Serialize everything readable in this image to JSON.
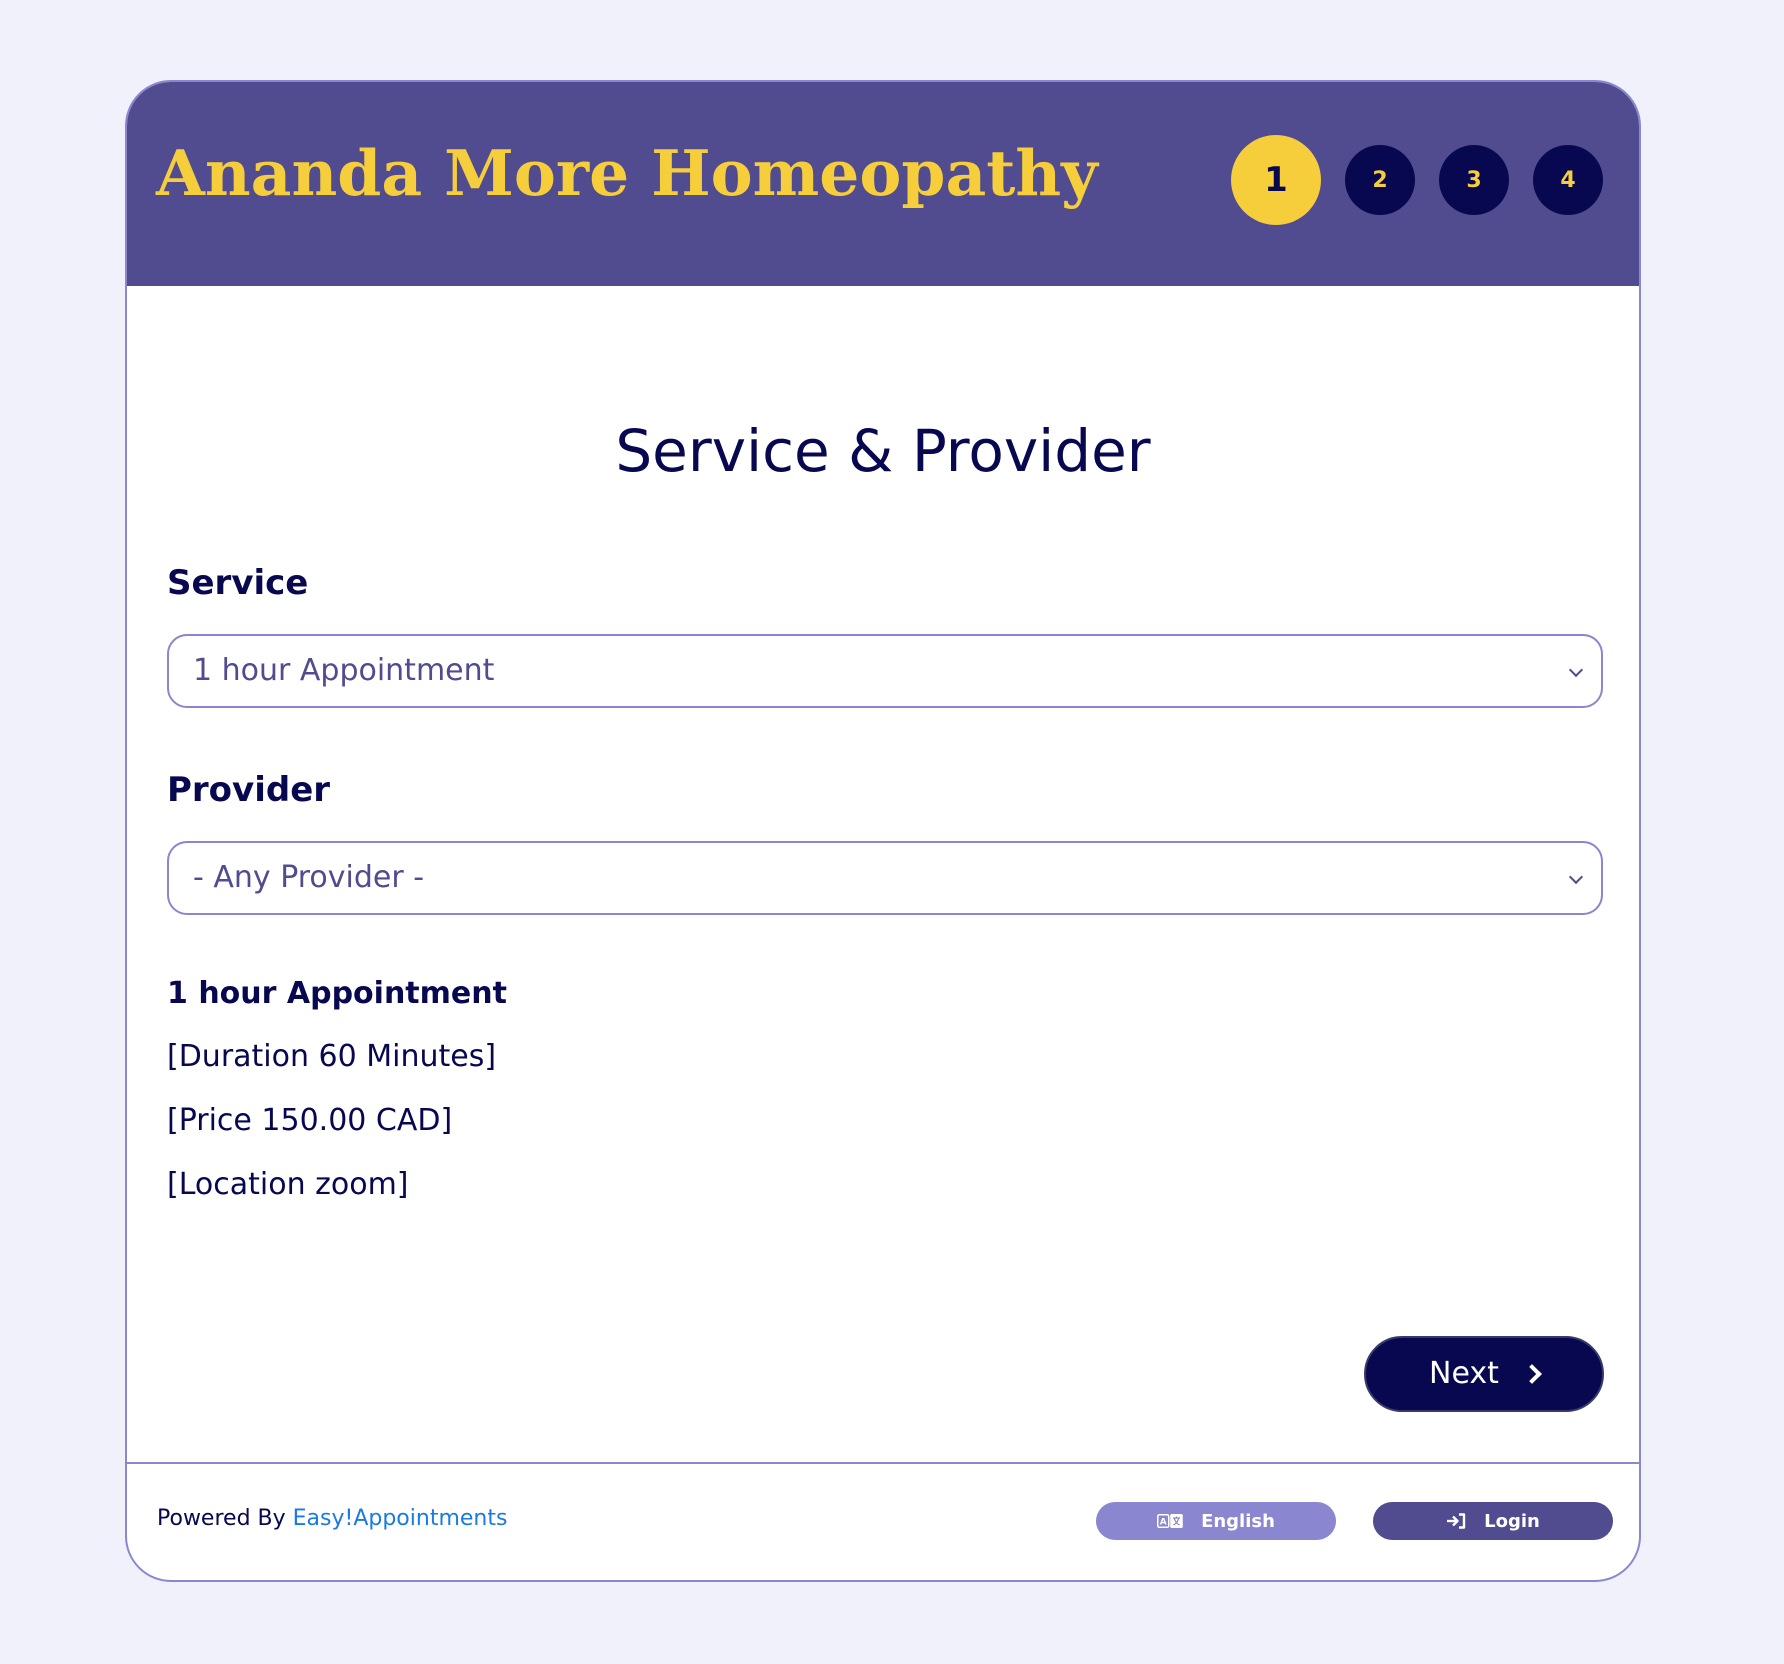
{
  "header": {
    "brand": "Ananda More Homeopathy",
    "steps": [
      "1",
      "2",
      "3",
      "4"
    ],
    "active_step": "1"
  },
  "main": {
    "title": "Service & Provider",
    "service": {
      "label": "Service",
      "selected": "1 hour Appointment"
    },
    "provider": {
      "label": "Provider",
      "selected": "- Any Provider -"
    },
    "details": {
      "title": "1 hour Appointment",
      "duration": "[Duration 60 Minutes]",
      "price": "[Price 150.00 CAD]",
      "location": "[Location zoom]"
    },
    "next_label": "Next"
  },
  "footer": {
    "powered_prefix": "Powered By ",
    "powered_link": "Easy!Appointments",
    "language_label": "English",
    "login_label": "Login"
  },
  "colors": {
    "header_bg": "#514b8f",
    "brand": "#f6ce3c",
    "navy": "#070850",
    "border": "#8a86cf",
    "link": "#1a7be0",
    "page_bg": "#f0f1fa"
  },
  "icons": {
    "language": "translate-icon",
    "login": "sign-in-icon",
    "next": "chevron-right-icon",
    "select": "chevron-down-icon"
  }
}
